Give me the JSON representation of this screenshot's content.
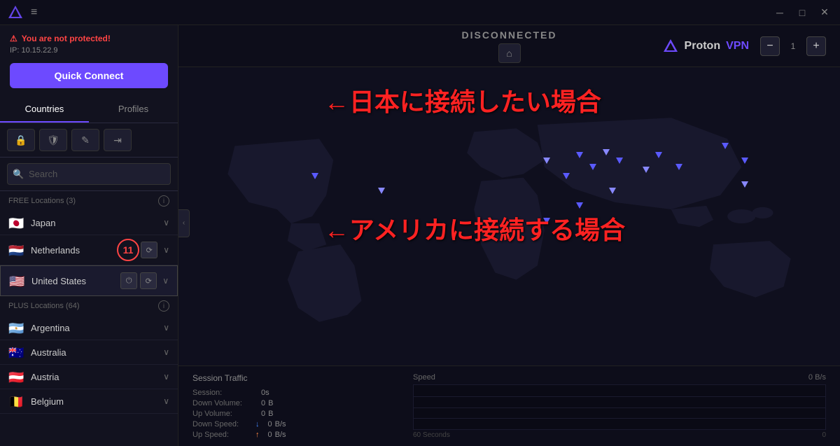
{
  "titlebar": {
    "minimize_label": "─",
    "maximize_label": "□",
    "close_label": "✕",
    "menu_icon": "≡"
  },
  "sidebar": {
    "protection_warning": "You are not protected!",
    "ip_label": "IP: 10.15.22.9",
    "quick_connect_label": "Quick Connect",
    "tabs": {
      "countries_label": "Countries",
      "profiles_label": "Profiles"
    },
    "filter_icons": [
      "🔒",
      "🛡",
      "✎",
      "⇥"
    ],
    "search_placeholder": "Search",
    "free_section_label": "FREE Locations (3)",
    "plus_section_label": "PLUS Locations (64)",
    "free_countries": [
      {
        "name": "Japan",
        "flag": "🇯🇵"
      },
      {
        "name": "Netherlands",
        "flag": "🇳🇱",
        "badge": "11"
      },
      {
        "name": "United States",
        "flag": "🇺🇸"
      }
    ],
    "plus_countries": [
      {
        "name": "Argentina",
        "flag": "🇦🇷"
      },
      {
        "name": "Australia",
        "flag": "🇦🇺"
      },
      {
        "name": "Austria",
        "flag": "🇦🇹"
      },
      {
        "name": "Belgium",
        "flag": "🇧🇪"
      }
    ]
  },
  "header": {
    "status_label": "DISCONNECTED",
    "home_icon": "⌂",
    "logo_text": "Proton",
    "logo_sub": "VPN",
    "zoom_minus": "−",
    "zoom_level": "1",
    "zoom_plus": "+"
  },
  "annotations": {
    "japan_text": "←日本に接続したい場合",
    "america_text": "←アメリカに接続する場合"
  },
  "stats": {
    "session_traffic_label": "Session Traffic",
    "speed_label": "Speed",
    "speed_value": "0 B/s",
    "rows": [
      {
        "label": "Session:",
        "value": "0s"
      },
      {
        "label": "Down Volume:",
        "value": "0",
        "unit": "B"
      },
      {
        "label": "Up Volume:",
        "value": "0",
        "unit": "B"
      },
      {
        "label": "Down Speed:",
        "value": "0",
        "unit": "B/s",
        "arrow": "down"
      },
      {
        "label": "Up Speed:",
        "value": "0",
        "unit": "B/s",
        "arrow": "up"
      }
    ],
    "graph_time_label": "60 Seconds",
    "graph_right_label": "0"
  },
  "map_dots": [
    {
      "top": "30%",
      "left": "55%"
    },
    {
      "top": "28%",
      "left": "60%"
    },
    {
      "top": "32%",
      "left": "62%"
    },
    {
      "top": "27%",
      "left": "64%"
    },
    {
      "top": "30%",
      "left": "66%"
    },
    {
      "top": "35%",
      "left": "58%"
    },
    {
      "top": "33%",
      "left": "70%"
    },
    {
      "top": "28%",
      "left": "72%"
    },
    {
      "top": "32%",
      "left": "75%"
    },
    {
      "top": "40%",
      "left": "65%"
    },
    {
      "top": "45%",
      "left": "60%"
    },
    {
      "top": "50%",
      "left": "55%"
    },
    {
      "top": "38%",
      "left": "85%"
    },
    {
      "top": "25%",
      "left": "82%"
    },
    {
      "top": "30%",
      "left": "85%"
    },
    {
      "top": "40%",
      "left": "30%"
    },
    {
      "top": "35%",
      "left": "20%"
    }
  ]
}
